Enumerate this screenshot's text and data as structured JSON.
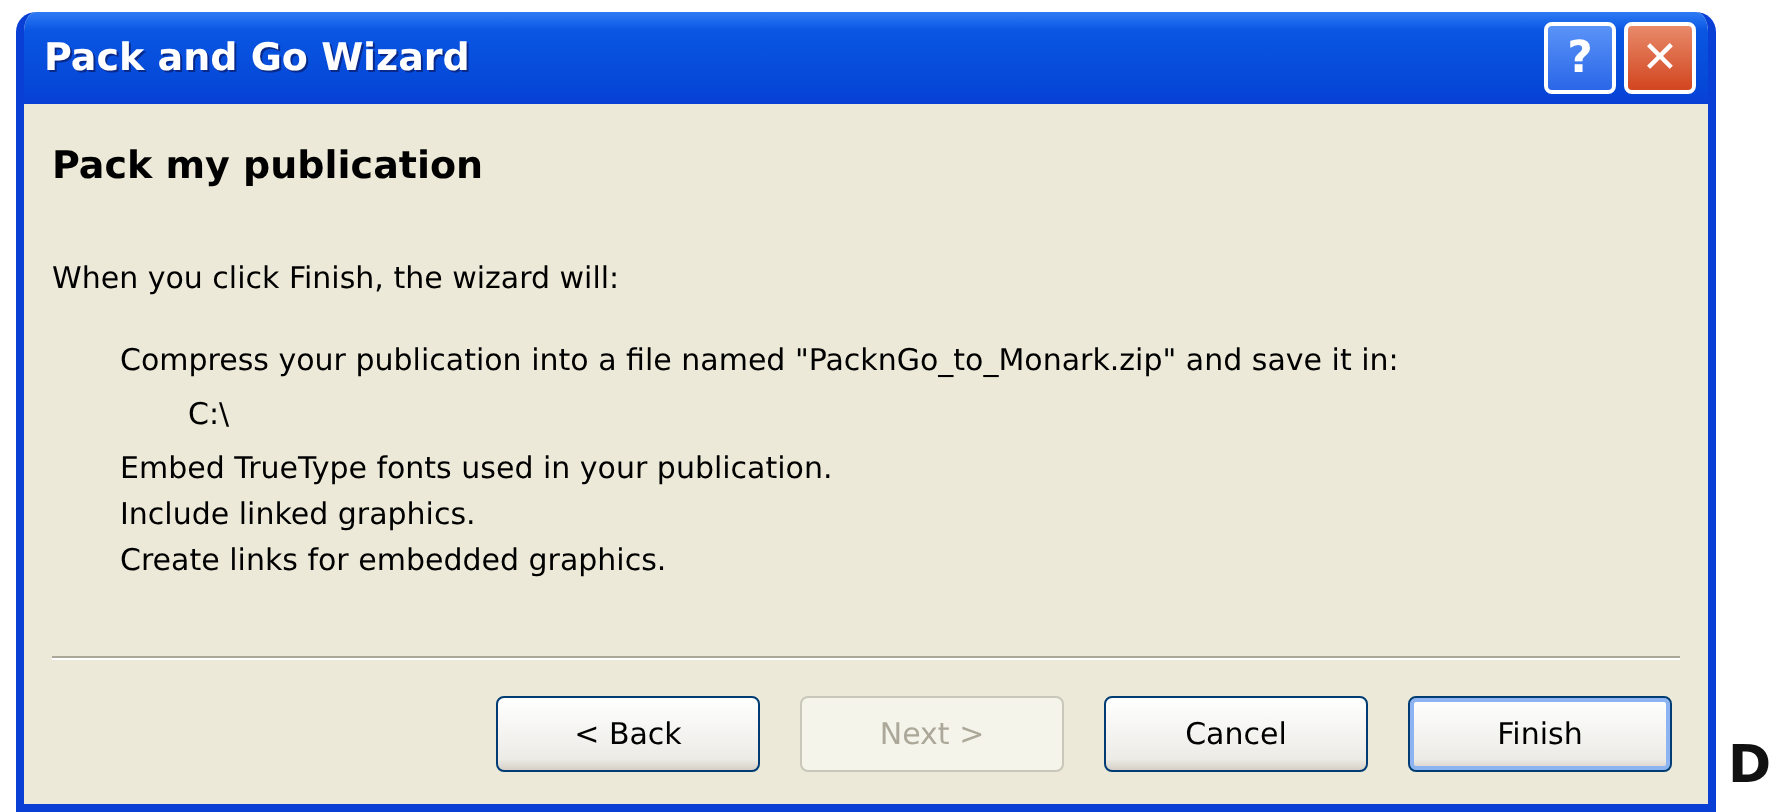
{
  "window": {
    "title": "Pack and Go Wizard",
    "controls": [
      "?",
      "✕"
    ]
  },
  "heading": "Pack my publication",
  "intro": "When you click Finish, the wizard will:",
  "steps": [
    {
      "text": "Compress your publication into a file named \"PacknGo_to_Monark.zip\" and save it in:",
      "children": [
        {
          "text": "C:\\"
        }
      ]
    },
    {
      "text": "Embed TrueType fonts used in your publication."
    },
    {
      "text": "Include linked graphics."
    },
    {
      "text": "Create links for embedded graphics."
    }
  ],
  "buttons": [
    {
      "label": "< Back",
      "disabled": false,
      "default": false
    },
    {
      "label": "Next >",
      "disabled": true,
      "default": false
    },
    {
      "label": "Cancel",
      "disabled": false,
      "default": false
    },
    {
      "label": "Finish",
      "disabled": false,
      "default": true
    }
  ],
  "margin_letter": "D"
}
